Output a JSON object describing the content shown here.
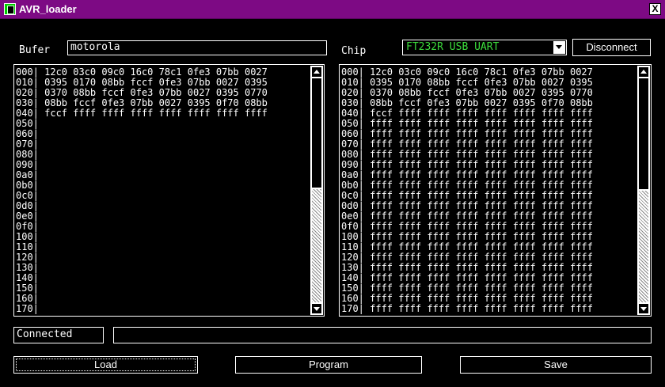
{
  "window": {
    "title": "AVR_loader",
    "close_glyph": "X",
    "accent": "#7d0a84"
  },
  "buffer": {
    "label": "Bufer",
    "name": "motorola"
  },
  "chip": {
    "label": "Chip",
    "device": "FT232R USB UART",
    "disconnect_label": "Disconnect"
  },
  "left_panel": {
    "lines": [
      "000| 12c0 03c0 09c0 16c0 78c1 0fe3 07bb 0027",
      "010| 0395 0170 08bb fccf 0fe3 07bb 0027 0395",
      "020| 0370 08bb fccf 0fe3 07bb 0027 0395 0770",
      "030| 08bb fccf 0fe3 07bb 0027 0395 0f70 08bb",
      "040| fccf ffff ffff ffff ffff ffff ffff ffff",
      "050|",
      "060|",
      "070|",
      "080|",
      "090|",
      "0a0|",
      "0b0|",
      "0c0|",
      "0d0|",
      "0e0|",
      "0f0|",
      "100|",
      "110|",
      "120|",
      "130|",
      "140|",
      "150|",
      "160|",
      "170|"
    ]
  },
  "right_panel": {
    "lines": [
      "000| 12c0 03c0 09c0 16c0 78c1 0fe3 07bb 0027",
      "010| 0395 0170 08bb fccf 0fe3 07bb 0027 0395",
      "020| 0370 08bb fccf 0fe3 07bb 0027 0395 0770",
      "030| 08bb fccf 0fe3 07bb 0027 0395 0f70 08bb",
      "040| fccf ffff ffff ffff ffff ffff ffff ffff",
      "050| ffff ffff ffff ffff ffff ffff ffff ffff",
      "060| ffff ffff ffff ffff ffff ffff ffff ffff",
      "070| ffff ffff ffff ffff ffff ffff ffff ffff",
      "080| ffff ffff ffff ffff ffff ffff ffff ffff",
      "090| ffff ffff ffff ffff ffff ffff ffff ffff",
      "0a0| ffff ffff ffff ffff ffff ffff ffff ffff",
      "0b0| ffff ffff ffff ffff ffff ffff ffff ffff",
      "0c0| ffff ffff ffff ffff ffff ffff ffff ffff",
      "0d0| ffff ffff ffff ffff ffff ffff ffff ffff",
      "0e0| ffff ffff ffff ffff ffff ffff ffff ffff",
      "0f0| ffff ffff ffff ffff ffff ffff ffff ffff",
      "100| ffff ffff ffff ffff ffff ffff ffff ffff",
      "110| ffff ffff ffff ffff ffff ffff ffff ffff",
      "120| ffff ffff ffff ffff ffff ffff ffff ffff",
      "130| ffff ffff ffff ffff ffff ffff ffff ffff",
      "140| ffff ffff ffff ffff ffff ffff ffff ffff",
      "150| ffff ffff ffff ffff ffff ffff ffff ffff",
      "160| ffff ffff ffff ffff ffff ffff ffff ffff",
      "170| ffff ffff ffff ffff ffff ffff ffff ffff"
    ]
  },
  "status": {
    "text": "Connected",
    "progress": 0
  },
  "actions": {
    "load": "Load",
    "program": "Program",
    "save": "Save"
  },
  "icons": {
    "app": "chip-icon",
    "close": "close-icon",
    "dropdown": "chevron-down-icon",
    "scroll_up": "arrow-up-icon",
    "scroll_down": "arrow-down-icon"
  },
  "colors": {
    "background": "#000000",
    "text": "#ffffff",
    "device_text": "#3cdc3c"
  }
}
